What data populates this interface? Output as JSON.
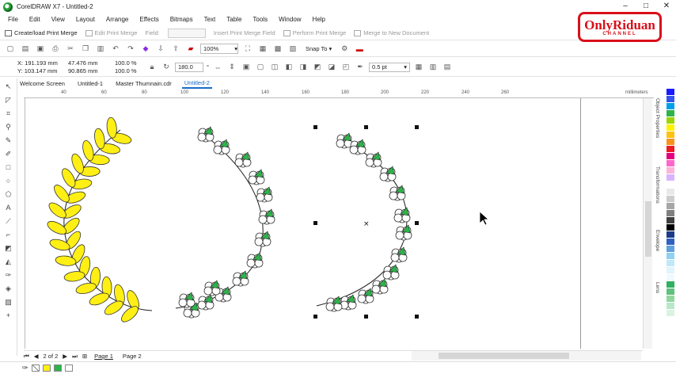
{
  "window": {
    "title": "CorelDRAW X7 - Untitled-2"
  },
  "menu": [
    "File",
    "Edit",
    "View",
    "Layout",
    "Arrange",
    "Effects",
    "Bitmaps",
    "Text",
    "Table",
    "Tools",
    "Window",
    "Help"
  ],
  "merge_toolbar": {
    "create_load": "Create/load Print Merge",
    "edit": "Edit Print Merge",
    "field_label": "Field:",
    "insert": "Insert Print Merge Field",
    "perform": "Perform Print Merge",
    "merge_doc": "Merge to New Document"
  },
  "standard_toolbar": {
    "zoom": "100%",
    "snap": "Snap To"
  },
  "property_bar": {
    "x": "X: 191.193 mm",
    "y": "Y: 103.147 mm",
    "w": "47.476 mm",
    "h": "90.865 mm",
    "sx": "100.0",
    "sy": "100.0",
    "pct": "%",
    "rotation": "180.0",
    "deg": "°",
    "outline": "0.5 pt"
  },
  "doc_tabs": [
    "Welcome Screen",
    "Untitled-1",
    "Master Thumnain.cdr",
    "Untitled-2"
  ],
  "ruler": {
    "marks": [
      "40",
      "60",
      "80",
      "100",
      "120",
      "140",
      "160",
      "180",
      "200",
      "220",
      "240",
      "260"
    ],
    "unit": "millimeters"
  },
  "dockers": [
    "Object Properties",
    "Transformations",
    "Envelope",
    "Lens"
  ],
  "page_nav": {
    "count": "2 of 2",
    "pages": [
      "Page 1",
      "Page 2"
    ],
    "active": "Page 1"
  },
  "palette": [
    "#1a1aff",
    "#3355ee",
    "#00a0e9",
    "#2db34a",
    "#9bd400",
    "#fff200",
    "#ffc20e",
    "#f7941d",
    "#ed1c24",
    "#e4007f",
    "#ff66cc",
    "#ffb3d9",
    "#d9b3ff",
    "#ffffff",
    "#e8e8e8",
    "#cccccc",
    "#a6a6a6",
    "#808080",
    "#404040",
    "#000000",
    "#1a3a8a",
    "#3060c0",
    "#60a0e0",
    "#90d0f0",
    "#c0e8f8",
    "#e0f4fc",
    "#f0fafe",
    "#30b060",
    "#60c080",
    "#90d8a0",
    "#b8e8c8",
    "#d8f4e0"
  ],
  "logo": {
    "line1": "OnlyRiduan",
    "line2": "CHANNEL"
  },
  "colors": {
    "accent": "#1a6cc8",
    "leaf_yellow": "#ffef14",
    "leaf_green": "#2db34a",
    "brand_red": "#d8101a"
  }
}
